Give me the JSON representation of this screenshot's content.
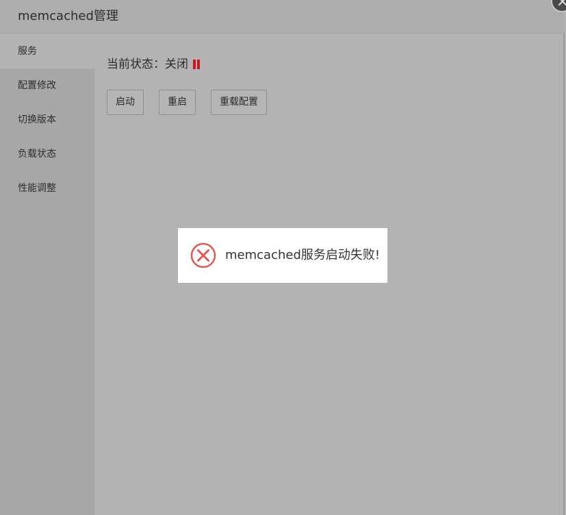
{
  "window": {
    "title": "memcached管理"
  },
  "sidebar": {
    "items": [
      {
        "label": "服务"
      },
      {
        "label": "配置修改"
      },
      {
        "label": "切换版本"
      },
      {
        "label": "负载状态"
      },
      {
        "label": "性能调整"
      }
    ]
  },
  "main": {
    "status_label": "当前状态：",
    "status_value": "关闭",
    "buttons": {
      "start": "启动",
      "restart": "重启",
      "reload": "重载配置"
    }
  },
  "toast": {
    "message": "memcached服务启动失败!",
    "icon": "error-circle-icon",
    "icon_color": "#e2564f"
  },
  "colors": {
    "status_paused": "#c8181e",
    "overlay": "#b3b3b3"
  }
}
